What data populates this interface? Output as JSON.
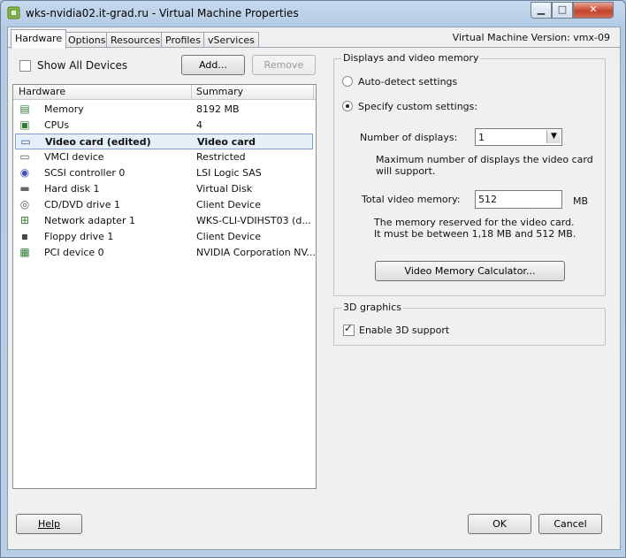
{
  "window": {
    "title": "wks-nvidia02.it-grad.ru - Virtual Machine Properties",
    "min_glyph": "▁",
    "max_glyph": "□",
    "close_glyph": "✕"
  },
  "tabs": [
    "Hardware",
    "Options",
    "Resources",
    "Profiles",
    "vServices"
  ],
  "vm_version": "Virtual Machine Version: vmx-09",
  "show_all_devices": {
    "label": "Show All Devices",
    "checked": false
  },
  "buttons": {
    "add": "Add...",
    "remove": "Remove",
    "help": "Help",
    "ok": "OK",
    "cancel": "Cancel",
    "calculator": "Video Memory Calculator..."
  },
  "hardware_list": {
    "headers": [
      "Hardware",
      "Summary"
    ],
    "rows": [
      {
        "name": "Memory",
        "summary": "8192 MB",
        "icon": "memory-icon",
        "glyph": "▤",
        "color": "#2e7d32"
      },
      {
        "name": "CPUs",
        "summary": "4",
        "icon": "cpu-icon",
        "glyph": "▣",
        "color": "#2e7d32"
      },
      {
        "name": "Video card  (edited)",
        "summary": "Video card",
        "icon": "monitor-icon",
        "glyph": "▭",
        "color": "#2f5f9e",
        "selected": true
      },
      {
        "name": "VMCI device",
        "summary": "Restricted",
        "icon": "vmci-icon",
        "glyph": "▭",
        "color": "#555"
      },
      {
        "name": "SCSI controller 0",
        "summary": "LSI Logic SAS",
        "icon": "scsi-icon",
        "glyph": "◉",
        "color": "#3f51b5"
      },
      {
        "name": "Hard disk 1",
        "summary": "Virtual Disk",
        "icon": "hard-disk-icon",
        "glyph": "▬",
        "color": "#666"
      },
      {
        "name": "CD/DVD drive 1",
        "summary": "Client Device",
        "icon": "cd-dvd-icon",
        "glyph": "◎",
        "color": "#555"
      },
      {
        "name": "Network adapter 1",
        "summary": "WKS-CLI-VDIHST03 (d...",
        "icon": "network-adapter-icon",
        "glyph": "⊞",
        "color": "#2e7d32"
      },
      {
        "name": "Floppy drive 1",
        "summary": "Client Device",
        "icon": "floppy-icon",
        "glyph": "▪",
        "color": "#444"
      },
      {
        "name": "PCI device 0",
        "summary": "NVIDIA Corporation NV...",
        "icon": "pci-icon",
        "glyph": "▦",
        "color": "#2e7d32"
      }
    ]
  },
  "displays": {
    "group_title": "Displays and video memory",
    "auto_detect": "Auto-detect settings",
    "custom": "Specify custom settings:",
    "selected_option": "custom",
    "num_displays_label": "Number of displays:",
    "num_displays_value": "1",
    "num_displays_note_1": "Maximum number of displays the video card",
    "num_displays_note_2": "will support.",
    "total_memory_label": "Total video memory:",
    "total_memory_value": "512",
    "total_memory_unit": "MB",
    "memory_note_1": "The memory reserved for the video card.",
    "memory_note_2": "It must be between 1,18 MB and 512 MB."
  },
  "graphics3d": {
    "group_title": "3D graphics",
    "enable_label": "Enable 3D support",
    "enabled": true
  }
}
